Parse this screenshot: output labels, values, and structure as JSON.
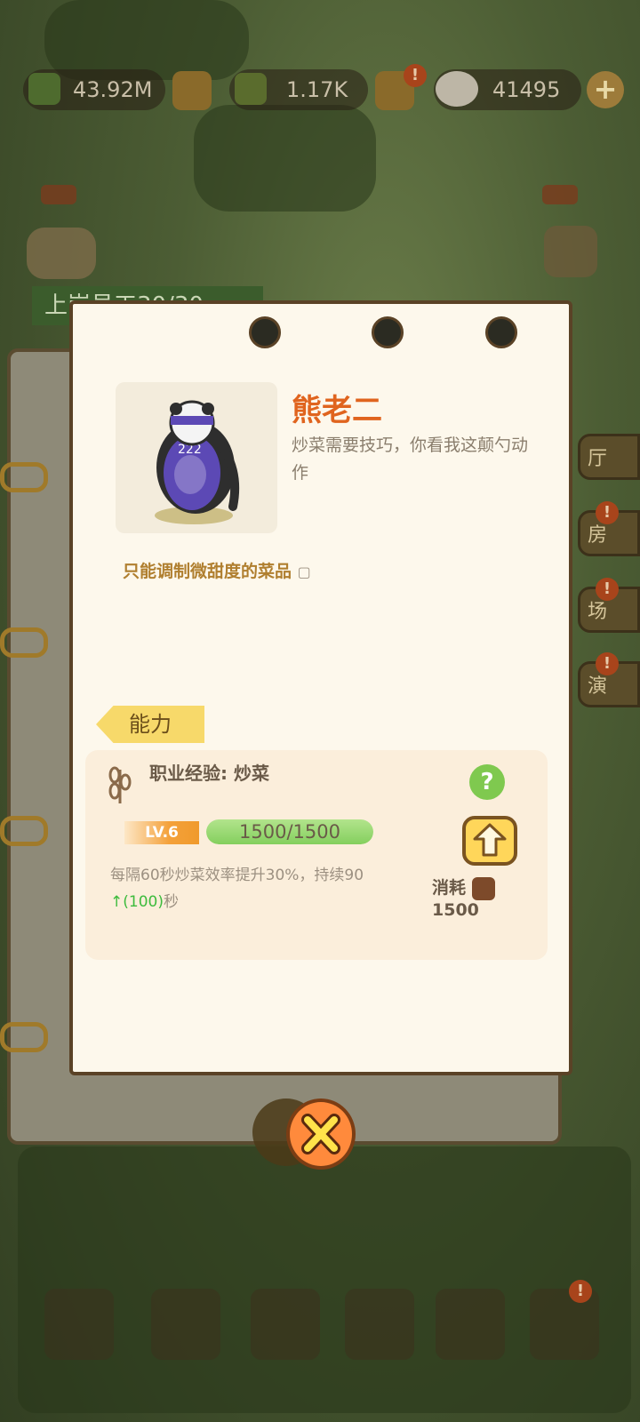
{
  "resources": [
    {
      "value": "43.92M",
      "icon": "bamboo-can-icon"
    },
    {
      "value": "1.17K",
      "icon": "bamboo-shoot-icon"
    },
    {
      "value": "41495",
      "icon": "panda-icon"
    }
  ],
  "alert_symbol": "!",
  "plus_symbol": "+",
  "staff_banner": "上岗员工30/30",
  "side_tabs": [
    "厅",
    "房",
    "场",
    "演"
  ],
  "character": {
    "name": "熊老二",
    "description": "炒菜需要技巧，你看我这颠勺动作"
  },
  "note": "只能调制微甜度的菜品",
  "ability_tab": "能力",
  "skill": {
    "title": "职业经验:  炒菜",
    "level": "LV.6",
    "progress_text": "1500/1500",
    "progress_fraction": 1.0,
    "effect": "每隔60秒炒菜效率提升30%，持续90",
    "effect_bonus": "↑(100)",
    "effect_suffix": "秒",
    "cost_label": "消耗",
    "cost_value": "1500",
    "help_symbol": "?"
  },
  "colors": {
    "name": "#e0641e",
    "note": "#b07f2f",
    "progress": "#84cf5e",
    "level_tag": "#f4a13a",
    "upgrade": "#ffd65a",
    "close": "#ff8a3c"
  }
}
